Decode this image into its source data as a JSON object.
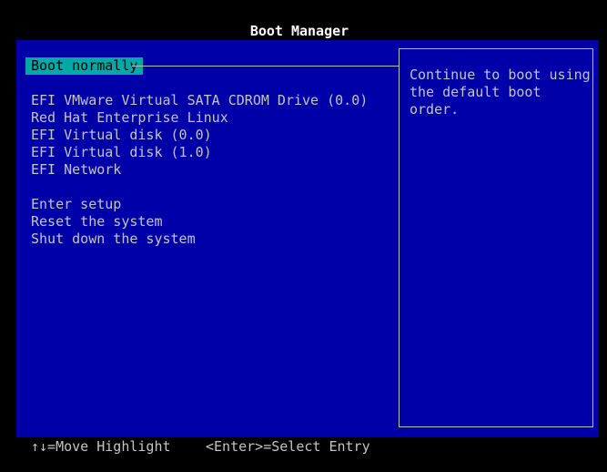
{
  "title": "Boot Manager",
  "menu": {
    "items": [
      {
        "label": "Boot normally",
        "selected": true
      },
      {
        "label": "EFI VMware Virtual SATA CDROM Drive (0.0)",
        "selected": false
      },
      {
        "label": "Red Hat Enterprise Linux",
        "selected": false
      },
      {
        "label": "EFI Virtual disk (0.0)",
        "selected": false
      },
      {
        "label": "EFI Virtual disk (1.0)",
        "selected": false
      },
      {
        "label": "EFI Network",
        "selected": false
      },
      {
        "label": "Enter setup",
        "selected": false
      },
      {
        "label": "Reset the system",
        "selected": false
      },
      {
        "label": "Shut down the system",
        "selected": false
      }
    ]
  },
  "help": {
    "text": "Continue to boot using\nthe default boot order."
  },
  "footer": {
    "move_hint": "↑↓=Move Highlight",
    "select_hint": "<Enter>=Select Entry"
  },
  "colors": {
    "background": "#0000a8",
    "highlight": "#00a8a8",
    "text": "#c4c4c4",
    "title": "#ffffff"
  }
}
